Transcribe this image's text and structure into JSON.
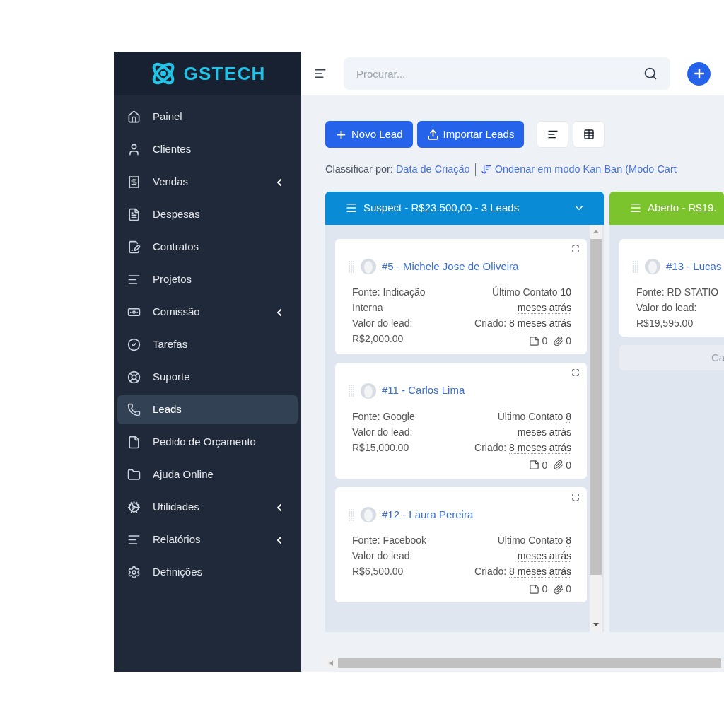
{
  "logo": {
    "text": "GSTECH"
  },
  "sidebar": {
    "items": [
      {
        "label": "Painel",
        "has_submenu": false,
        "selected": false
      },
      {
        "label": "Clientes",
        "has_submenu": false,
        "selected": false
      },
      {
        "label": "Vendas",
        "has_submenu": true,
        "selected": false
      },
      {
        "label": "Despesas",
        "has_submenu": false,
        "selected": false
      },
      {
        "label": "Contratos",
        "has_submenu": false,
        "selected": false
      },
      {
        "label": "Projetos",
        "has_submenu": false,
        "selected": false
      },
      {
        "label": "Comissão",
        "has_submenu": true,
        "selected": false
      },
      {
        "label": "Tarefas",
        "has_submenu": false,
        "selected": false
      },
      {
        "label": "Suporte",
        "has_submenu": false,
        "selected": false
      },
      {
        "label": "Leads",
        "has_submenu": false,
        "selected": true
      },
      {
        "label": "Pedido de Orçamento",
        "has_submenu": false,
        "selected": false
      },
      {
        "label": "Ajuda Online",
        "has_submenu": false,
        "selected": false
      },
      {
        "label": "Utilidades",
        "has_submenu": true,
        "selected": false
      },
      {
        "label": "Relatórios",
        "has_submenu": true,
        "selected": false
      },
      {
        "label": "Definições",
        "has_submenu": false,
        "selected": false
      }
    ]
  },
  "header": {
    "search": {
      "placeholder": "Procurar..."
    }
  },
  "toolbar": {
    "buttons": [
      {
        "kind": "primary",
        "label": "Novo Lead"
      },
      {
        "kind": "primary",
        "label": "Importar Leads"
      },
      {
        "kind": "icon"
      },
      {
        "kind": "icon"
      }
    ]
  },
  "sort_bar": {
    "label": "Classificar por:",
    "sort_field": "Data de Criação",
    "order_link": "Ondenar em modo Kan Ban (Modo Cart"
  },
  "columns": [
    {
      "title": "Suspect - R$23.500,00 - 3 Leads",
      "color": "#0a8bd6",
      "show_toggle": true,
      "cards": [
        {
          "title": "#5 - Michele Jose de Oliveira",
          "source": "Fonte: Indicação Interna",
          "value_label": "Valor do lead:",
          "value": "R$2,000.00",
          "last_contact_label": "Último Contato",
          "last_contact": "10 meses atrás",
          "created_label": "Criado:",
          "created": "8 meses atrás",
          "notes": "0",
          "attachments": "0"
        },
        {
          "title": "#11 - Carlos Lima",
          "source": "Fonte: Google",
          "value_label": "Valor do lead:",
          "value": "R$15,000.00",
          "last_contact_label": "Último Contato",
          "last_contact": "8 meses atrás",
          "created_label": "Criado:",
          "created": "8 meses atrás",
          "notes": "0",
          "attachments": "0"
        },
        {
          "title": "#12 - Laura Pereira",
          "source": "Fonte: Facebook",
          "value_label": "Valor do lead:",
          "value": "R$6,500.00",
          "last_contact_label": "Último Contato",
          "last_contact": "8 meses atrás",
          "created_label": "Criado:",
          "created": "8 meses atrás",
          "notes": "0",
          "attachments": "0"
        }
      ]
    },
    {
      "title": "Aberto - R$19.",
      "color": "#7cc42e",
      "show_toggle": false,
      "footer_button": "Ca",
      "cards": [
        {
          "title": "#13 - Lucas",
          "source": "Fonte: RD STATIO",
          "value_label": "Valor do lead:",
          "value": "R$19,595.00"
        }
      ]
    }
  ]
}
